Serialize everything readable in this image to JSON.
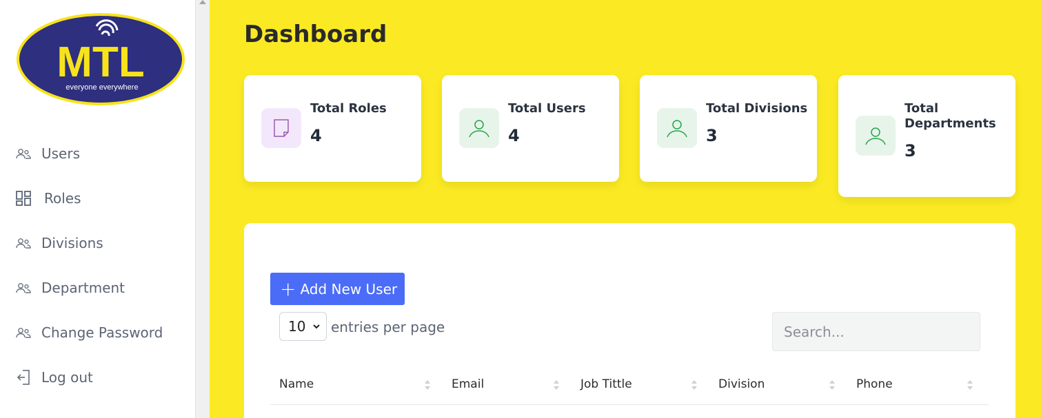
{
  "logo": {
    "main_text": "MTL",
    "tagline": "everyone everywhere",
    "colors": {
      "oval": "#2e2f7e",
      "ring": "#f7e31b",
      "text": "#f7e31b"
    }
  },
  "sidebar": {
    "items": [
      {
        "label": "Users",
        "icon": "users-icon"
      },
      {
        "label": "Roles",
        "icon": "grid-icon"
      },
      {
        "label": "Divisions",
        "icon": "users-icon"
      },
      {
        "label": "Department",
        "icon": "users-icon"
      },
      {
        "label": "Change Password",
        "icon": "users-icon"
      },
      {
        "label": "Log out",
        "icon": "logout-icon"
      }
    ]
  },
  "page": {
    "title": "Dashboard"
  },
  "cards": [
    {
      "title": "Total Roles",
      "value": "4",
      "icon": "document-icon",
      "icon_bg": "#f3e8fb",
      "icon_color": "#9b59b6"
    },
    {
      "title": "Total Users",
      "value": "4",
      "icon": "user-icon",
      "icon_bg": "#e7f4ea",
      "icon_color": "#22a34a"
    },
    {
      "title": "Total Divisions",
      "value": "3",
      "icon": "user-icon",
      "icon_bg": "#e7f4ea",
      "icon_color": "#22a34a"
    },
    {
      "title": "Total Departments",
      "value": "3",
      "icon": "user-icon",
      "icon_bg": "#e7f4ea",
      "icon_color": "#22a34a"
    }
  ],
  "table": {
    "add_button_label": "Add New User",
    "entries_value": "10",
    "entries_label": "entries per page",
    "search_placeholder": "Search...",
    "columns": [
      "Name",
      "Email",
      "Job Tittle",
      "Division",
      "Phone"
    ]
  },
  "colors": {
    "background": "#fbea23",
    "primary": "#4a6cf7"
  }
}
